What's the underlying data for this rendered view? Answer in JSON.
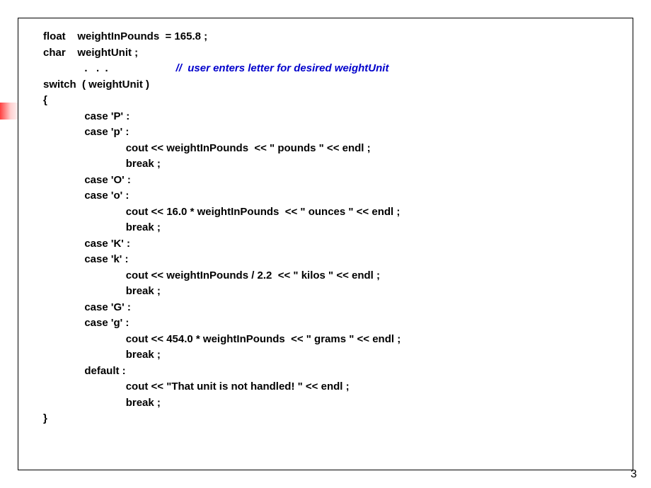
{
  "code": {
    "l01": "float    weightInPounds  = 165.8 ;",
    "l02": "char    weightUnit ;",
    "l03a": "              .   .  .                       ",
    "l03b": "//  user enters letter for desired weightUnit",
    "l04": "switch  ( weightUnit )",
    "l05": "{",
    "l06": "              case 'P' :",
    "l07": "              case 'p' :",
    "l08": "                            cout << weightInPounds  << \" pounds \" << endl ;",
    "l09": "                            break ;",
    "l10": "              case 'O' :",
    "l11": "              case 'o' :",
    "l12": "                            cout << 16.0 * weightInPounds  << \" ounces \" << endl ;",
    "l13": "                            break ;",
    "l14": "              case 'K' :",
    "l15": "              case 'k' :",
    "l16": "                            cout << weightInPounds / 2.2  << \" kilos \" << endl ;",
    "l17": "                            break ;",
    "l18": "              case 'G' :",
    "l19": "              case 'g' :",
    "l20": "                            cout << 454.0 * weightInPounds  << \" grams \" << endl ;",
    "l21": "                            break ;",
    "l22": "              default :",
    "l23": "                            cout << \"That unit is not handled! \" << endl ;",
    "l24": "                            break ;",
    "l25": "}"
  },
  "page_number": "3"
}
